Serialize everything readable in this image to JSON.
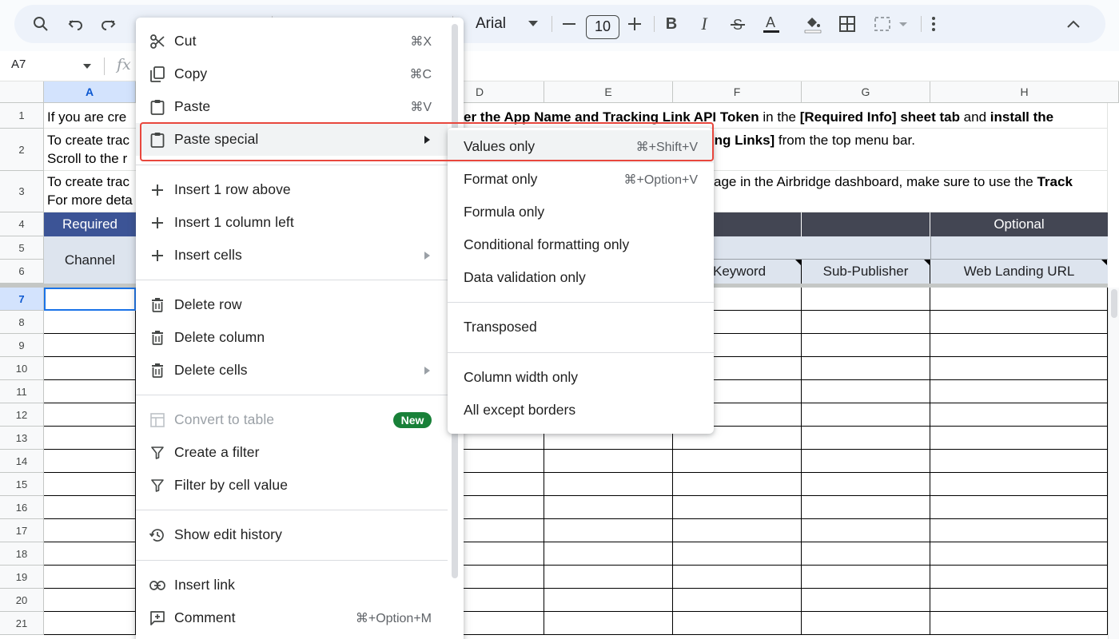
{
  "toolbar": {
    "font_name": "Arial",
    "font_size": "10",
    "icons": [
      "search-icon",
      "undo-icon",
      "redo-icon",
      "print-icon",
      "paint-format-icon",
      "font-dropdown-icon",
      "decrease-font-icon",
      "increase-font-icon",
      "bold-icon",
      "italic-icon",
      "strikethrough-icon",
      "text-color-icon",
      "fill-color-icon",
      "borders-icon",
      "merge-cells-icon",
      "more-icon",
      "collapse-icon"
    ]
  },
  "formula_bar": {
    "cell_ref": "A7",
    "fx": "fx"
  },
  "columns": [
    "A",
    "D",
    "E",
    "F",
    "G",
    "H"
  ],
  "rows": [
    "1",
    "2",
    "3",
    "4",
    "5",
    "6",
    "7",
    "8",
    "9",
    "10",
    "11",
    "12",
    "13",
    "14",
    "15",
    "16",
    "17",
    "18",
    "19",
    "20",
    "21"
  ],
  "sheet": {
    "r1_a": "If you are cre",
    "r1_mid_bold": "er the App Name and Tracking Link API Token",
    "r1_in_the": " in the ",
    "r1_req_bold": "[Required Info] sheet tab",
    "r1_and": " and ",
    "r1_install_bold": "install the",
    "r2_a_line1": "To create trac",
    "r2_a_line2": "Scroll to the r",
    "r2_mid_bold": "cking Links]",
    "r2_mid_rest": " from the top menu bar.",
    "r3_a_line1": "To create trac",
    "r3_a_line2": "For more deta",
    "r3_mid": "age in the Airbridge dashboard, make sure to use the ",
    "r3_mid_bold": "Track",
    "required": "Required",
    "optional": "Optional",
    "channel": "Channel",
    "keyword": "Keyword",
    "sub_publisher": "Sub-Publisher",
    "web_landing_url": "Web Landing URL"
  },
  "context_menu": {
    "cut": "Cut",
    "cut_sc": "⌘X",
    "copy": "Copy",
    "copy_sc": "⌘C",
    "paste": "Paste",
    "paste_sc": "⌘V",
    "paste_special": "Paste special",
    "insert_row": "Insert 1 row above",
    "insert_col": "Insert 1 column left",
    "insert_cells": "Insert cells",
    "delete_row": "Delete row",
    "delete_col": "Delete column",
    "delete_cells": "Delete cells",
    "convert_table": "Convert to table",
    "new_badge": "New",
    "create_filter": "Create a filter",
    "filter_by_value": "Filter by cell value",
    "show_edit_history": "Show edit history",
    "insert_link": "Insert link",
    "comment": "Comment",
    "comment_sc": "⌘+Option+M"
  },
  "submenu": {
    "values_only": "Values only",
    "values_only_sc": "⌘+Shift+V",
    "format_only": "Format only",
    "format_only_sc": "⌘+Option+V",
    "formula_only": "Formula only",
    "cond_format_only": "Conditional formatting only",
    "data_validation_only": "Data validation only",
    "transposed": "Transposed",
    "column_width_only": "Column width only",
    "all_except_borders": "All except borders"
  },
  "colors": {
    "highlight": "#e8473d",
    "badge": "#188038",
    "header_dark": "#434653",
    "header_blue": "#3c5496",
    "header_light": "#dde4ee",
    "selection": "#1a73e8"
  }
}
